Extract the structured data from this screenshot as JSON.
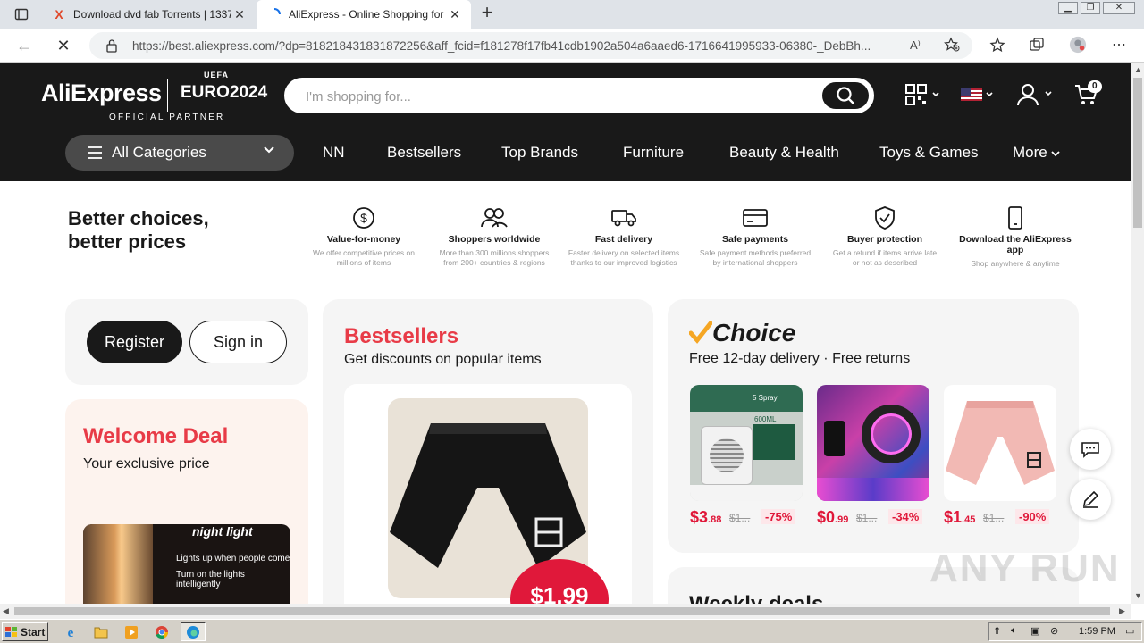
{
  "browser": {
    "tabs": [
      {
        "title": "Download dvd fab Torrents | 1337",
        "close": "✕"
      },
      {
        "title": "AliExpress - Online Shopping for",
        "close": "✕"
      }
    ],
    "new_tab": "+",
    "url": "https://best.aliexpress.com/?dp=818218431831872256&aff_fcid=f181278f17fb41cdb1902a504a6aaed6-1716641995933-06380-_DebBh...",
    "read_aloud": "A⁾"
  },
  "header": {
    "logo": "AliExpress",
    "euro_uefa": "UEFA",
    "euro": "EURO2024",
    "official_partner": "OFFICIAL PARTNER",
    "search_placeholder": "I'm shopping for...",
    "cart_count": "0",
    "all_categories": "All Categories",
    "nav": [
      "NN",
      "Bestsellers",
      "Top Brands",
      "Furniture",
      "Beauty & Health",
      "Toys & Games",
      "More"
    ]
  },
  "value_props": {
    "title_line1": "Better choices,",
    "title_line2": "better prices",
    "items": [
      {
        "icon": "dollar-icon",
        "name": "Value-for-money",
        "desc1": "We offer competitive prices on",
        "desc2": "millions of items"
      },
      {
        "icon": "users-icon",
        "name": "Shoppers worldwide",
        "desc1": "More than 300 millions shoppers",
        "desc2": "from 200+ countries & regions"
      },
      {
        "icon": "truck-icon",
        "name": "Fast delivery",
        "desc1": "Faster delivery on selected items",
        "desc2": "thanks to our improved logistics"
      },
      {
        "icon": "card-icon",
        "name": "Safe payments",
        "desc1": "Safe payment methods preferred",
        "desc2": "by international shoppers"
      },
      {
        "icon": "shield-icon",
        "name": "Buyer protection",
        "desc1": "Get a refund if items arrive late",
        "desc2": "or not as described"
      },
      {
        "icon": "phone-icon",
        "name": "Download the AliExpress app",
        "desc1": "Shop anywhere & anytime",
        "desc2": ""
      }
    ]
  },
  "account": {
    "register": "Register",
    "sign_in": "Sign in"
  },
  "welcome": {
    "title": "Welcome Deal",
    "subtitle": "Your exclusive price",
    "promo_title": "night light",
    "promo_line1": "Lights up when people come",
    "promo_line2": "Turn on the lights intelligently"
  },
  "bestsellers": {
    "title": "Bestsellers",
    "subtitle": "Get discounts on popular items",
    "price": "$1.99"
  },
  "choice": {
    "logo": "Choice",
    "subtitle": "Free 12-day delivery · Free returns",
    "products": [
      {
        "price_main": "$3",
        "price_cents": ".88",
        "old": "$1...",
        "discount": "-75%"
      },
      {
        "price_main": "$0",
        "price_cents": ".99",
        "old": "$1...",
        "discount": "-34%"
      },
      {
        "price_main": "$1",
        "price_cents": ".45",
        "old": "$1...",
        "discount": "-90%"
      }
    ],
    "fan_label1": "5 Spray",
    "fan_label2": "600ML"
  },
  "weekly": {
    "title": "Weekly deals"
  },
  "watermark": "ANY RUN",
  "taskbar": {
    "start": "Start",
    "clock": "1:59 PM"
  },
  "colors": {
    "brand_red": "#e83b47",
    "header_bg": "#191919",
    "price_red": "#e0183a"
  }
}
